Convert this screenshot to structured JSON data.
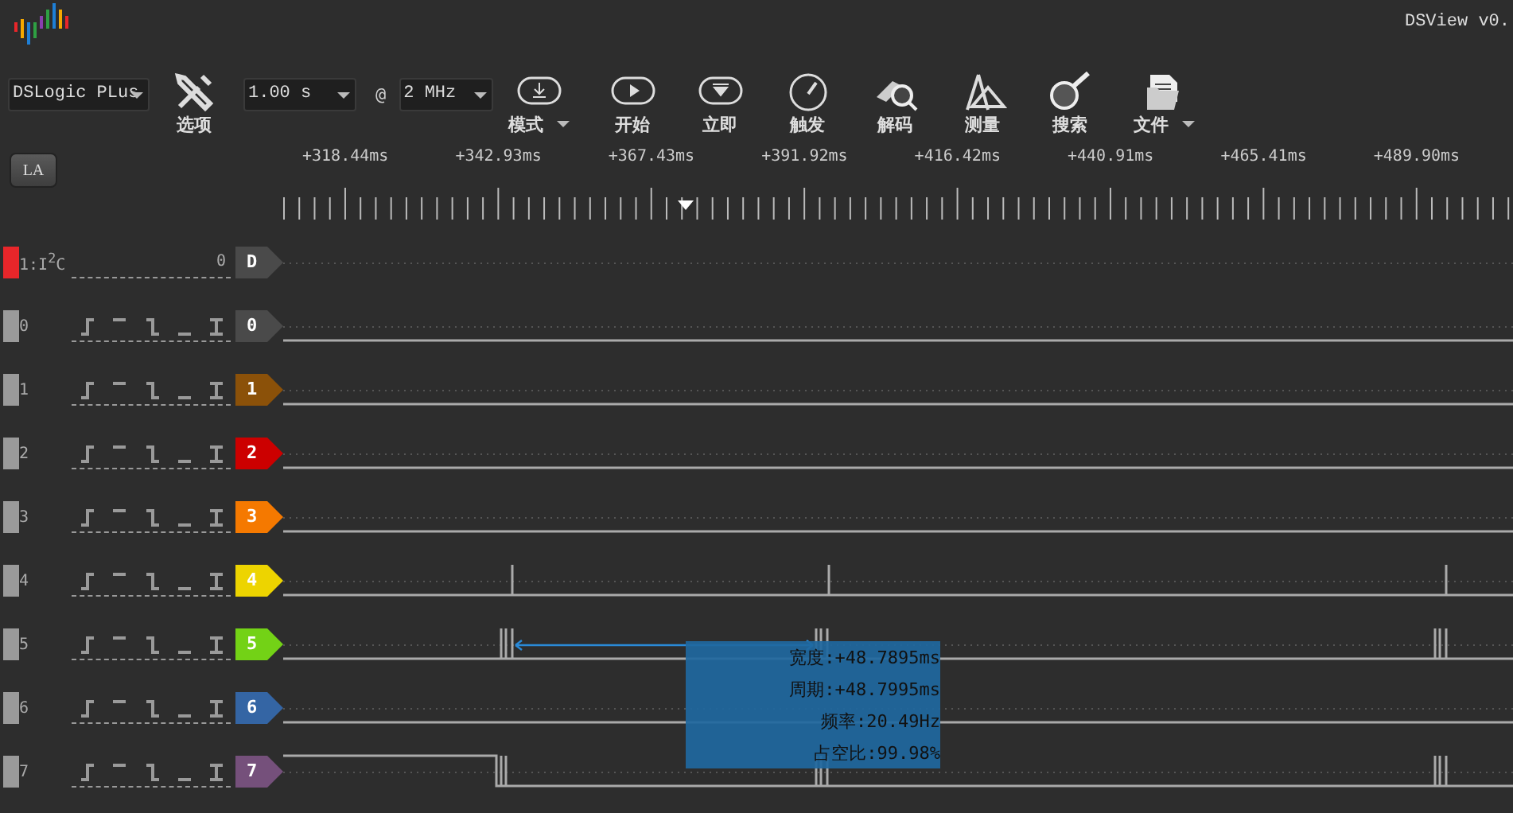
{
  "window": {
    "title": "DSView v0."
  },
  "toolbar": {
    "device": "DSLogic PLus",
    "options": "选项",
    "duration": "1.00 s",
    "at": "@",
    "rate": "2 MHz",
    "buttons": [
      {
        "kind": "mode",
        "label": "模式",
        "menu": true
      },
      {
        "kind": "start",
        "label": "开始",
        "menu": false
      },
      {
        "kind": "instant",
        "label": "立即",
        "menu": false
      },
      {
        "kind": "trigger",
        "label": "触发",
        "menu": false
      },
      {
        "kind": "decode",
        "label": "解码",
        "menu": false
      },
      {
        "kind": "measure",
        "label": "测量",
        "menu": false
      },
      {
        "kind": "search",
        "label": "搜索",
        "menu": false
      },
      {
        "kind": "file",
        "label": "文件",
        "menu": true
      }
    ]
  },
  "ruler": {
    "mode_button": "LA",
    "ticks": [
      "+318.44ms",
      "+342.93ms",
      "+367.43ms",
      "+391.92ms",
      "+416.42ms",
      "+440.91ms",
      "+465.41ms",
      "+489.90ms"
    ]
  },
  "channels": [
    {
      "kind": "decoder",
      "label": "1:I$^{2}$C",
      "value": "0",
      "tag": "D",
      "color": "#4a4a4a"
    },
    {
      "kind": "logic",
      "label": "0",
      "tag": "0",
      "color": "#4a4a4a"
    },
    {
      "kind": "logic",
      "label": "1",
      "tag": "1",
      "color": "#8b5109"
    },
    {
      "kind": "logic",
      "label": "2",
      "tag": "2",
      "color": "#cc0000"
    },
    {
      "kind": "logic",
      "label": "3",
      "tag": "3",
      "color": "#f57900"
    },
    {
      "kind": "logic",
      "label": "4",
      "tag": "4",
      "color": "#edd400"
    },
    {
      "kind": "logic",
      "label": "5",
      "tag": "5",
      "color": "#73d216"
    },
    {
      "kind": "logic",
      "label": "6",
      "tag": "6",
      "color": "#3465a4"
    },
    {
      "kind": "logic",
      "label": "7",
      "tag": "7",
      "color": "#75507b"
    }
  ],
  "measurement": [
    "宽度:+48.7895ms",
    "周期:+48.7995ms",
    "频率:20.49Hz",
    "占空比:99.98%"
  ]
}
